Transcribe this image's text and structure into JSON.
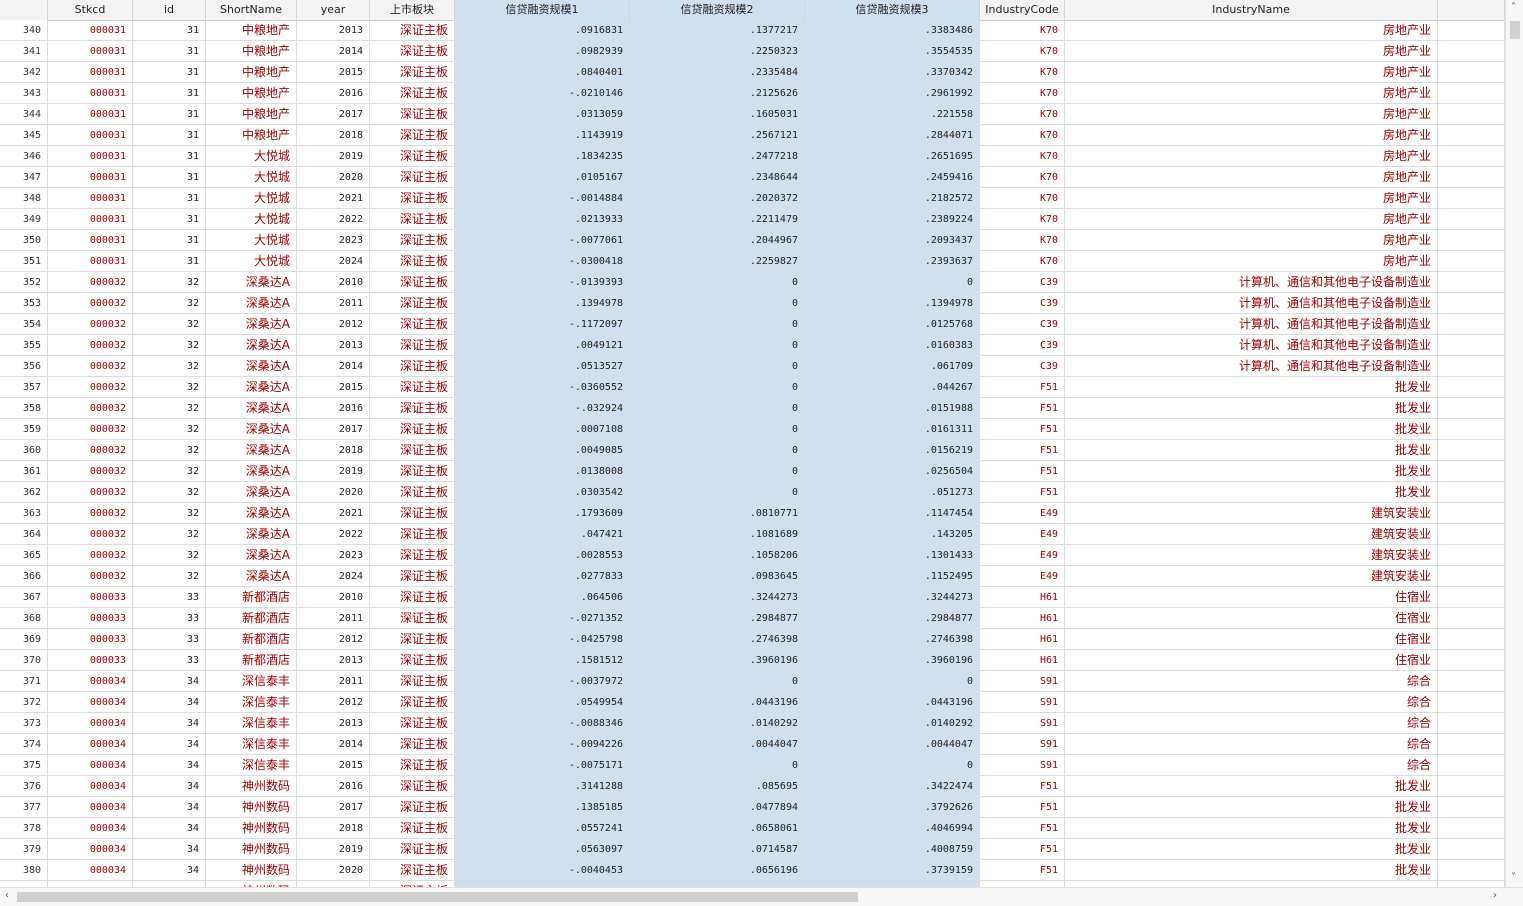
{
  "columns": [
    {
      "key": "obs",
      "label": ""
    },
    {
      "key": "Stkcd",
      "label": "Stkcd"
    },
    {
      "key": "id",
      "label": "id"
    },
    {
      "key": "ShortName",
      "label": "ShortName"
    },
    {
      "key": "year",
      "label": "year"
    },
    {
      "key": "board",
      "label": "上市板块"
    },
    {
      "key": "s1",
      "label": "信贷融资规模1"
    },
    {
      "key": "s2",
      "label": "信贷融资规模2"
    },
    {
      "key": "s3",
      "label": "信贷融资规模3"
    },
    {
      "key": "IndustryCode",
      "label": "IndustryCode"
    },
    {
      "key": "IndustryName",
      "label": "IndustryName"
    },
    {
      "key": "extra",
      "label": ""
    }
  ],
  "rows": [
    [
      "340",
      "000031",
      "31",
      "中粮地产",
      "2013",
      "深证主板",
      ".0916831",
      ".1377217",
      ".3383486",
      "K70",
      "房地产业"
    ],
    [
      "341",
      "000031",
      "31",
      "中粮地产",
      "2014",
      "深证主板",
      ".0982939",
      ".2250323",
      ".3554535",
      "K70",
      "房地产业"
    ],
    [
      "342",
      "000031",
      "31",
      "中粮地产",
      "2015",
      "深证主板",
      ".0840401",
      ".2335484",
      ".3370342",
      "K70",
      "房地产业"
    ],
    [
      "343",
      "000031",
      "31",
      "中粮地产",
      "2016",
      "深证主板",
      "-.0210146",
      ".2125626",
      ".2961992",
      "K70",
      "房地产业"
    ],
    [
      "344",
      "000031",
      "31",
      "中粮地产",
      "2017",
      "深证主板",
      ".0313059",
      ".1605031",
      ".221558",
      "K70",
      "房地产业"
    ],
    [
      "345",
      "000031",
      "31",
      "中粮地产",
      "2018",
      "深证主板",
      ".1143919",
      ".2567121",
      ".2844071",
      "K70",
      "房地产业"
    ],
    [
      "346",
      "000031",
      "31",
      "大悦城",
      "2019",
      "深证主板",
      ".1834235",
      ".2477218",
      ".2651695",
      "K70",
      "房地产业"
    ],
    [
      "347",
      "000031",
      "31",
      "大悦城",
      "2020",
      "深证主板",
      ".0105167",
      ".2348644",
      ".2459416",
      "K70",
      "房地产业"
    ],
    [
      "348",
      "000031",
      "31",
      "大悦城",
      "2021",
      "深证主板",
      "-.0014884",
      ".2020372",
      ".2182572",
      "K70",
      "房地产业"
    ],
    [
      "349",
      "000031",
      "31",
      "大悦城",
      "2022",
      "深证主板",
      ".0213933",
      ".2211479",
      ".2389224",
      "K70",
      "房地产业"
    ],
    [
      "350",
      "000031",
      "31",
      "大悦城",
      "2023",
      "深证主板",
      "-.0077061",
      ".2044967",
      ".2093437",
      "K70",
      "房地产业"
    ],
    [
      "351",
      "000031",
      "31",
      "大悦城",
      "2024",
      "深证主板",
      "-.0300418",
      ".2259827",
      ".2393637",
      "K70",
      "房地产业"
    ],
    [
      "352",
      "000032",
      "32",
      "深桑达A",
      "2010",
      "深证主板",
      "-.0139393",
      "0",
      "0",
      "C39",
      "计算机、通信和其他电子设备制造业"
    ],
    [
      "353",
      "000032",
      "32",
      "深桑达A",
      "2011",
      "深证主板",
      ".1394978",
      "0",
      ".1394978",
      "C39",
      "计算机、通信和其他电子设备制造业"
    ],
    [
      "354",
      "000032",
      "32",
      "深桑达A",
      "2012",
      "深证主板",
      "-.1172097",
      "0",
      ".0125768",
      "C39",
      "计算机、通信和其他电子设备制造业"
    ],
    [
      "355",
      "000032",
      "32",
      "深桑达A",
      "2013",
      "深证主板",
      ".0049121",
      "0",
      ".0160383",
      "C39",
      "计算机、通信和其他电子设备制造业"
    ],
    [
      "356",
      "000032",
      "32",
      "深桑达A",
      "2014",
      "深证主板",
      ".0513527",
      "0",
      ".061709",
      "C39",
      "计算机、通信和其他电子设备制造业"
    ],
    [
      "357",
      "000032",
      "32",
      "深桑达A",
      "2015",
      "深证主板",
      "-.0360552",
      "0",
      ".044267",
      "F51",
      "批发业"
    ],
    [
      "358",
      "000032",
      "32",
      "深桑达A",
      "2016",
      "深证主板",
      "-.032924",
      "0",
      ".0151988",
      "F51",
      "批发业"
    ],
    [
      "359",
      "000032",
      "32",
      "深桑达A",
      "2017",
      "深证主板",
      ".0007108",
      "0",
      ".0161311",
      "F51",
      "批发业"
    ],
    [
      "360",
      "000032",
      "32",
      "深桑达A",
      "2018",
      "深证主板",
      ".0049085",
      "0",
      ".0156219",
      "F51",
      "批发业"
    ],
    [
      "361",
      "000032",
      "32",
      "深桑达A",
      "2019",
      "深证主板",
      ".0138008",
      "0",
      ".0256504",
      "F51",
      "批发业"
    ],
    [
      "362",
      "000032",
      "32",
      "深桑达A",
      "2020",
      "深证主板",
      ".0303542",
      "0",
      ".051273",
      "F51",
      "批发业"
    ],
    [
      "363",
      "000032",
      "32",
      "深桑达A",
      "2021",
      "深证主板",
      ".1793609",
      ".0810771",
      ".1147454",
      "E49",
      "建筑安装业"
    ],
    [
      "364",
      "000032",
      "32",
      "深桑达A",
      "2022",
      "深证主板",
      ".047421",
      ".1081689",
      ".143205",
      "E49",
      "建筑安装业"
    ],
    [
      "365",
      "000032",
      "32",
      "深桑达A",
      "2023",
      "深证主板",
      ".0028553",
      ".1058206",
      ".1301433",
      "E49",
      "建筑安装业"
    ],
    [
      "366",
      "000032",
      "32",
      "深桑达A",
      "2024",
      "深证主板",
      ".0277833",
      ".0983645",
      ".1152495",
      "E49",
      "建筑安装业"
    ],
    [
      "367",
      "000033",
      "33",
      "新都酒店",
      "2010",
      "深证主板",
      ".064506",
      ".3244273",
      ".3244273",
      "H61",
      "住宿业"
    ],
    [
      "368",
      "000033",
      "33",
      "新都酒店",
      "2011",
      "深证主板",
      "-.0271352",
      ".2984877",
      ".2984877",
      "H61",
      "住宿业"
    ],
    [
      "369",
      "000033",
      "33",
      "新都酒店",
      "2012",
      "深证主板",
      "-.0425798",
      ".2746398",
      ".2746398",
      "H61",
      "住宿业"
    ],
    [
      "370",
      "000033",
      "33",
      "新都酒店",
      "2013",
      "深证主板",
      ".1581512",
      ".3960196",
      ".3960196",
      "H61",
      "住宿业"
    ],
    [
      "371",
      "000034",
      "34",
      "深信泰丰",
      "2011",
      "深证主板",
      "-.0037972",
      "0",
      "0",
      "S91",
      "综合"
    ],
    [
      "372",
      "000034",
      "34",
      "深信泰丰",
      "2012",
      "深证主板",
      ".0549954",
      ".0443196",
      ".0443196",
      "S91",
      "综合"
    ],
    [
      "373",
      "000034",
      "34",
      "深信泰丰",
      "2013",
      "深证主板",
      "-.0088346",
      ".0140292",
      ".0140292",
      "S91",
      "综合"
    ],
    [
      "374",
      "000034",
      "34",
      "深信泰丰",
      "2014",
      "深证主板",
      "-.0094226",
      ".0044047",
      ".0044047",
      "S91",
      "综合"
    ],
    [
      "375",
      "000034",
      "34",
      "深信泰丰",
      "2015",
      "深证主板",
      "-.0075171",
      "0",
      "0",
      "S91",
      "综合"
    ],
    [
      "376",
      "000034",
      "34",
      "神州数码",
      "2016",
      "深证主板",
      ".3141288",
      ".085695",
      ".3422474",
      "F51",
      "批发业"
    ],
    [
      "377",
      "000034",
      "34",
      "神州数码",
      "2017",
      "深证主板",
      ".1385185",
      ".0477894",
      ".3792626",
      "F51",
      "批发业"
    ],
    [
      "378",
      "000034",
      "34",
      "神州数码",
      "2018",
      "深证主板",
      ".0557241",
      ".0658061",
      ".4046994",
      "F51",
      "批发业"
    ],
    [
      "379",
      "000034",
      "34",
      "神州数码",
      "2019",
      "深证主板",
      ".0563097",
      ".0714587",
      ".4008759",
      "F51",
      "批发业"
    ],
    [
      "380",
      "000034",
      "34",
      "神州数码",
      "2020",
      "深证主板",
      "-.0040453",
      ".0656196",
      ".3739159",
      "F51",
      "批发业"
    ],
    [
      "",
      "",
      "",
      "神州数码",
      "",
      "深证主板",
      "",
      "",
      "",
      "",
      ""
    ]
  ],
  "scroll": {
    "up_arrow": "˄",
    "down_arrow": "˅",
    "left_arrow": "‹",
    "right_arrow": "›"
  },
  "colors": {
    "selected_column_bg": "#cfe0f0",
    "string_text": "#a00000"
  }
}
